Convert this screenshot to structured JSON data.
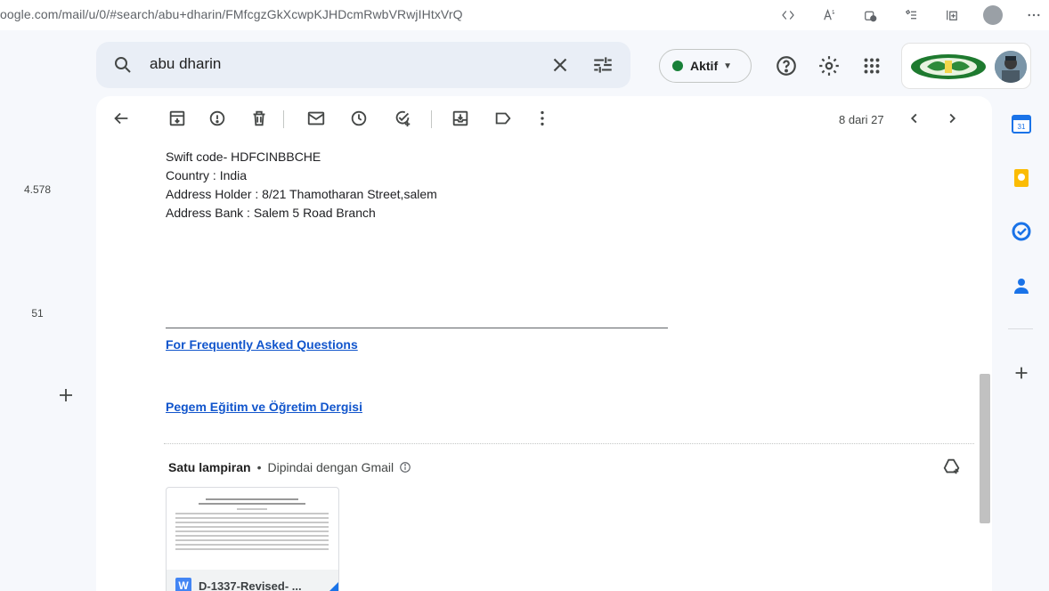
{
  "browser": {
    "url": "oogle.com/mail/u/0/#search/abu+dharin/FMfcgzGkXcwpKJHDcmRwbVRwjIHtxVrQ",
    "icons": [
      "reader-mode-icon",
      "read-aloud-icon",
      "extensions-icon",
      "favorites-icon",
      "collections-icon",
      "profile-icon",
      "more-icon"
    ]
  },
  "search": {
    "value": "abu dharin",
    "icons": [
      "search-icon",
      "clear-icon",
      "search-options-icon"
    ]
  },
  "status": {
    "label": "Aktif"
  },
  "rail": {
    "count_a": "4.578",
    "count_b": "51"
  },
  "toolbar": {
    "pager": "8 dari 27"
  },
  "email": {
    "lines": [
      "Swift code- HDFCINBBCHE",
      "Country : India",
      "Address Holder : 8/21 Thamotharan Street,salem",
      "Address Bank : Salem 5 Road Branch"
    ],
    "link_faq": "For Frequently Asked Questions",
    "link_journal": "Pegem Eğitim ve Öğretim Dergisi"
  },
  "attachment": {
    "title": "Satu lampiran",
    "bullet": "•",
    "subtitle": "Dipindai dengan Gmail",
    "file_badge": "W",
    "file_name": "D-1337-Revised- ..."
  },
  "side_panel": {
    "calendar_day": "31"
  },
  "colors": {
    "link": "#1155cc",
    "status_green": "#188038",
    "search_bg": "#e9eef6",
    "page_bg": "#f6f8fc"
  }
}
